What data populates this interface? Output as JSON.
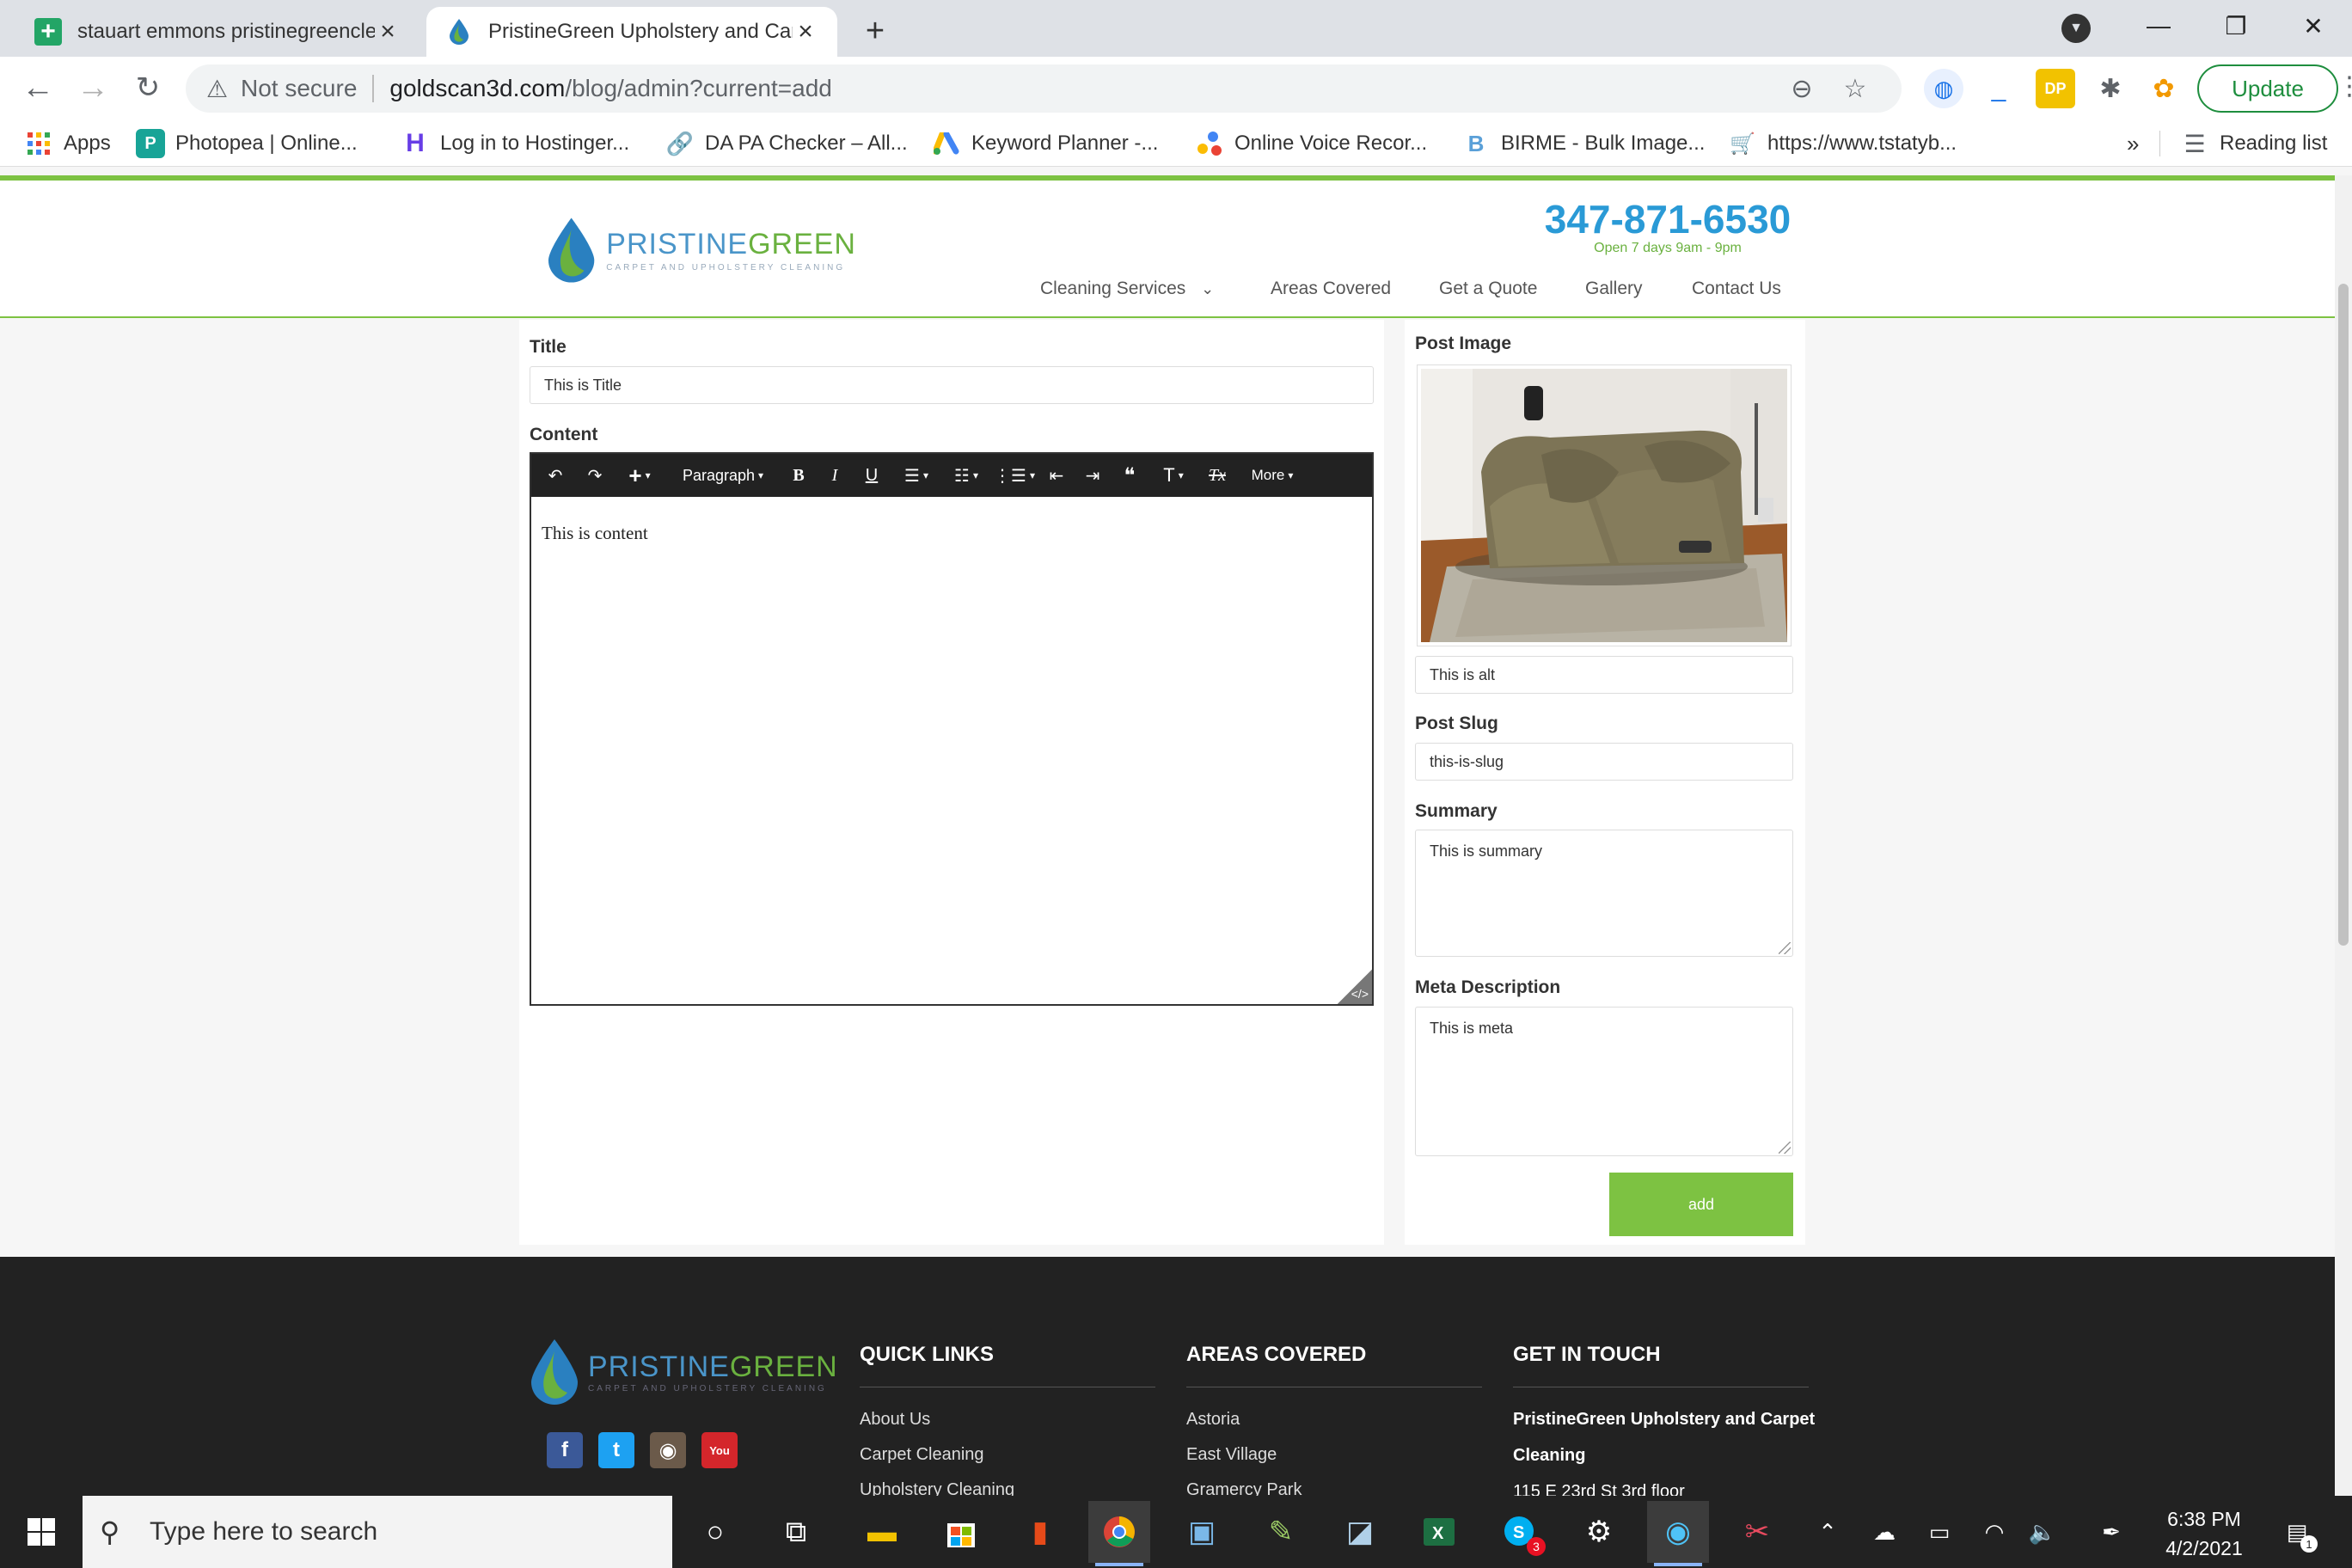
{
  "browser": {
    "tabs": [
      {
        "title": "stauart emmons pristinegreenclea",
        "active": false
      },
      {
        "title": "PristineGreen Upholstery and Carp",
        "active": true
      }
    ],
    "new_tab": "+",
    "address": {
      "security": "Not secure",
      "host": "goldscan3d.com",
      "path": "/blog/admin?current=add"
    },
    "update_label": "Update",
    "bookmarks": [
      {
        "label": "Apps",
        "icon": "apps-grid-icon"
      },
      {
        "label": "Photopea | Online...",
        "icon": "photopea-icon"
      },
      {
        "label": "Log in to Hostinger...",
        "icon": "hostinger-icon"
      },
      {
        "label": "DA PA Checker – All...",
        "icon": "link-icon"
      },
      {
        "label": "Keyword Planner -...",
        "icon": "google-ads-icon"
      },
      {
        "label": "Online Voice Recor...",
        "icon": "voice-recorder-icon"
      },
      {
        "label": "BIRME - Bulk Image...",
        "icon": "birme-icon"
      },
      {
        "label": "https://www.tstatyb...",
        "icon": "cart-icon"
      }
    ],
    "bookmarks_more": "»",
    "reading_list": "Reading list"
  },
  "site": {
    "logo": {
      "brand_part1": "PRISTINE",
      "brand_part2": "GREEN",
      "tagline": "CARPET AND UPHOLSTERY CLEANING"
    },
    "phone": "347-871-6530",
    "hours": "Open 7 days 9am - 9pm",
    "menu": [
      "Cleaning Services",
      "Areas Covered",
      "Get a Quote",
      "Gallery",
      "Contact Us"
    ],
    "menu_caret": "⌄",
    "colors": {
      "green": "#7dc242",
      "blue": "#2a9ad6"
    }
  },
  "form": {
    "title_label": "Title",
    "title_value": "This is Title",
    "content_label": "Content",
    "content_value": "This is content",
    "editor_toolbar": {
      "paragraph": "Paragraph",
      "more": "More",
      "bold": "B",
      "italic": "I",
      "underline": "U",
      "quote": "❝",
      "text_size": "T",
      "clear_format": "Tx"
    },
    "post_image_label": "Post Image",
    "alt_value": "This is alt",
    "slug_label": "Post Slug",
    "slug_value": "this-is-slug",
    "summary_label": "Summary",
    "summary_value": "This is summary",
    "meta_label": "Meta Description",
    "meta_value": "This is meta",
    "submit_label": "add"
  },
  "footer": {
    "quick_links_title": "QUICK LINKS",
    "quick_links": [
      "About Us",
      "Carpet Cleaning",
      "Upholstery Cleaning"
    ],
    "areas_title": "AREAS COVERED",
    "areas": [
      "Astoria",
      "East Village",
      "Gramercy Park"
    ],
    "contact_title": "GET IN TOUCH",
    "company_line1": "PristineGreen Upholstery and Carpet",
    "company_line2": "Cleaning",
    "address": "115 E 23rd St 3rd floor",
    "social": [
      {
        "icon": "facebook-icon",
        "glyph": "f",
        "color": "#3b5998"
      },
      {
        "icon": "twitter-icon",
        "glyph": "t",
        "color": "#1da1f2"
      },
      {
        "icon": "instagram-icon",
        "glyph": "◉",
        "color": "#6b5a4a"
      },
      {
        "icon": "youtube-icon",
        "glyph": "You",
        "color": "#d4262b"
      }
    ]
  },
  "taskbar": {
    "search_placeholder": "Type here to search",
    "time": "6:38 PM",
    "date": "4/2/2021",
    "skype_badge": "3",
    "notification_badge": "1"
  }
}
